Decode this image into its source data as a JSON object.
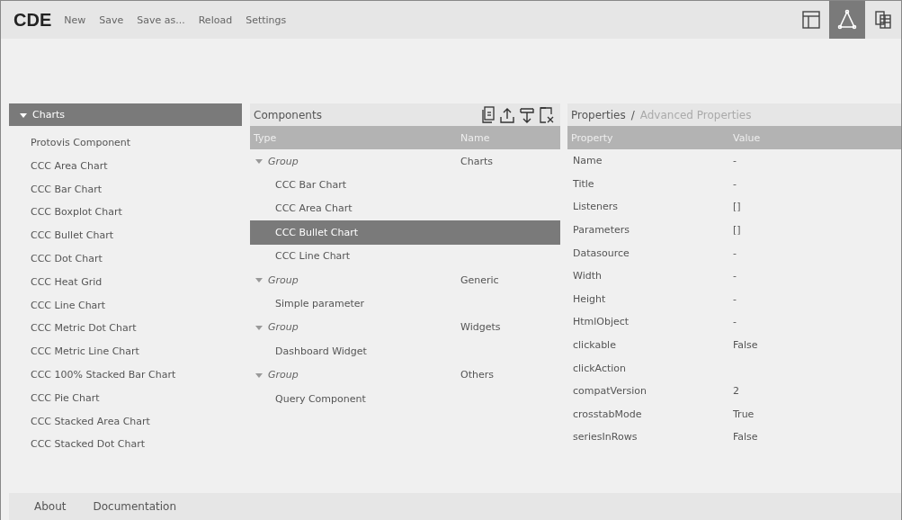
{
  "app": {
    "logo": "CDE",
    "menu": [
      "New",
      "Save",
      "Save as...",
      "Reload",
      "Settings"
    ],
    "views": [
      {
        "kind": "layout",
        "selected": false
      },
      {
        "kind": "components",
        "selected": true
      },
      {
        "kind": "datasources",
        "selected": false
      }
    ]
  },
  "sidebar": {
    "title": "Charts",
    "expanded": true,
    "items": [
      "Protovis Component",
      "CCC Area Chart",
      "CCC Bar Chart",
      "CCC Boxplot Chart",
      "CCC Bullet Chart",
      "CCC Dot Chart",
      "CCC Heat Grid",
      "CCC Line Chart",
      "CCC Metric Dot Chart",
      "CCC Metric Line Chart",
      "CCC 100% Stacked Bar Chart",
      "CCC Pie Chart",
      "CCC Stacked Area Chart",
      "CCC Stacked Dot Chart"
    ]
  },
  "components": {
    "title": "Components",
    "tools": [
      {
        "kind": "new"
      },
      {
        "kind": "up"
      },
      {
        "kind": "down"
      },
      {
        "kind": "delete"
      }
    ],
    "columns": [
      "Type",
      "Name"
    ],
    "rows": [
      {
        "type": "Group",
        "name": "Charts",
        "expanded": true,
        "selected": false,
        "children": [
          {
            "type": "CCC Bar Chart",
            "selected": false
          },
          {
            "type": "CCC Area Chart",
            "selected": false
          },
          {
            "type": "CCC Bullet Chart",
            "selected": true
          },
          {
            "type": "CCC Line Chart",
            "selected": false
          }
        ]
      },
      {
        "type": "Group",
        "name": "Generic",
        "expanded": true,
        "selected": false,
        "children": [
          {
            "type": "Simple parameter",
            "selected": false
          }
        ]
      },
      {
        "type": "Group",
        "name": "Widgets",
        "expanded": true,
        "selected": false,
        "children": [
          {
            "type": "Dashboard Widget",
            "selected": false
          }
        ]
      },
      {
        "type": "Group",
        "name": "Others",
        "expanded": true,
        "selected": false,
        "children": [
          {
            "type": "Query Component",
            "selected": false
          }
        ]
      }
    ]
  },
  "properties": {
    "title": "Properties",
    "separator": "/",
    "advanced": "Advanced Properties",
    "columns": [
      "Property",
      "Value"
    ],
    "rows": [
      {
        "property": "Name",
        "value": "-"
      },
      {
        "property": "Title",
        "value": "-"
      },
      {
        "property": "Listeners",
        "value": "[]"
      },
      {
        "property": "Parameters",
        "value": "[]"
      },
      {
        "property": "Datasource",
        "value": "-"
      },
      {
        "property": "Width",
        "value": "-"
      },
      {
        "property": "Height",
        "value": "-"
      },
      {
        "property": "HtmlObject",
        "value": "-"
      },
      {
        "property": "clickable",
        "value": "False"
      },
      {
        "property": "clickAction"
      },
      {
        "property": "compatVersion",
        "value": "2"
      },
      {
        "property": "crosstabMode",
        "value": "True"
      },
      {
        "property": "seriesInRows",
        "value": "False"
      }
    ]
  },
  "footer": [
    "About",
    "Documentation"
  ]
}
